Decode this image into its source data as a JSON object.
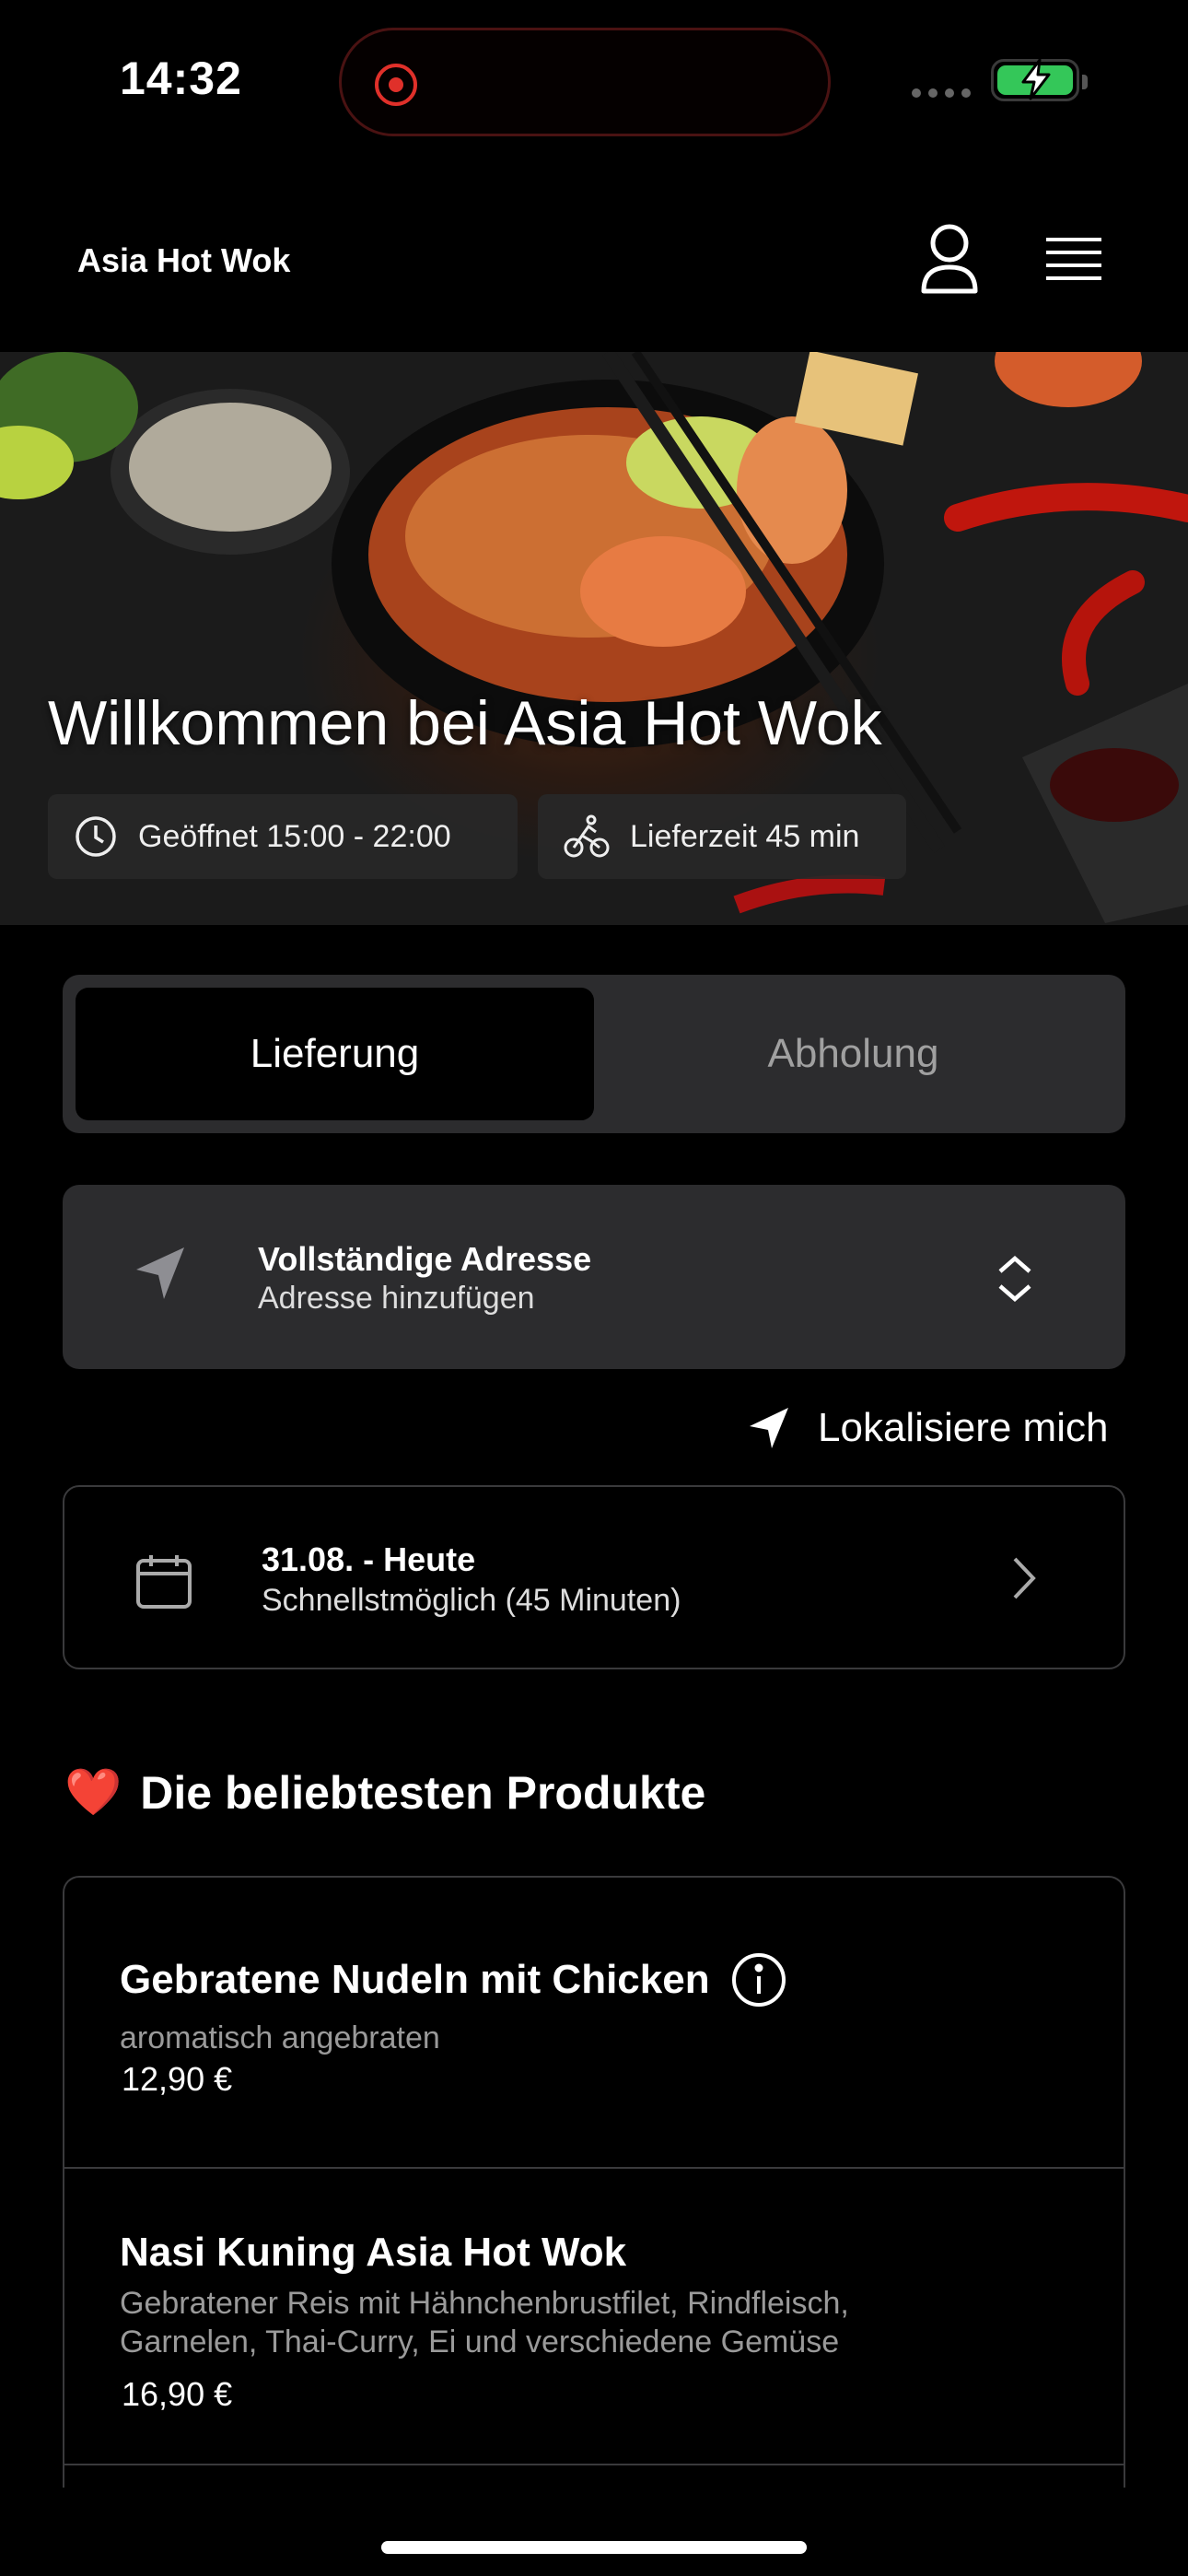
{
  "status_bar": {
    "time": "14:32"
  },
  "header": {
    "brand": "Asia Hot Wok"
  },
  "hero": {
    "title": "Willkommen bei Asia Hot Wok",
    "opening_hours": "Geöffnet 15:00 - 22:00",
    "delivery_time": "Lieferzeit 45 min"
  },
  "tabs": [
    {
      "label": "Lieferung",
      "active": true
    },
    {
      "label": "Abholung",
      "active": false
    }
  ],
  "address": {
    "title": "Vollständige Adresse",
    "subtitle": "Adresse hinzufügen"
  },
  "locate": {
    "label": "Lokalisiere mich"
  },
  "schedule": {
    "title": "31.08. - Heute",
    "subtitle": "Schnellstmöglich (45 Minuten)"
  },
  "section": {
    "emoji": "❤️",
    "title": "Die beliebtesten Produkte"
  },
  "products": [
    {
      "name": "Gebratene Nudeln mit Chicken",
      "description": "aromatisch angebraten",
      "price": "12,90 €"
    },
    {
      "name": "Nasi Kuning Asia Hot Wok",
      "description_line1": "Gebratener Reis mit Hähnchenbrustfilet, Rindfleisch,",
      "description_line2": "Garnelen, Thai-Curry, Ei und verschiedene Gemüse",
      "price": "16,90 €"
    }
  ],
  "colors": {
    "background": "#000000",
    "card": "#2c2c2e",
    "border": "#3a3a3c",
    "battery": "#34c759",
    "recording": "#e0302a"
  }
}
